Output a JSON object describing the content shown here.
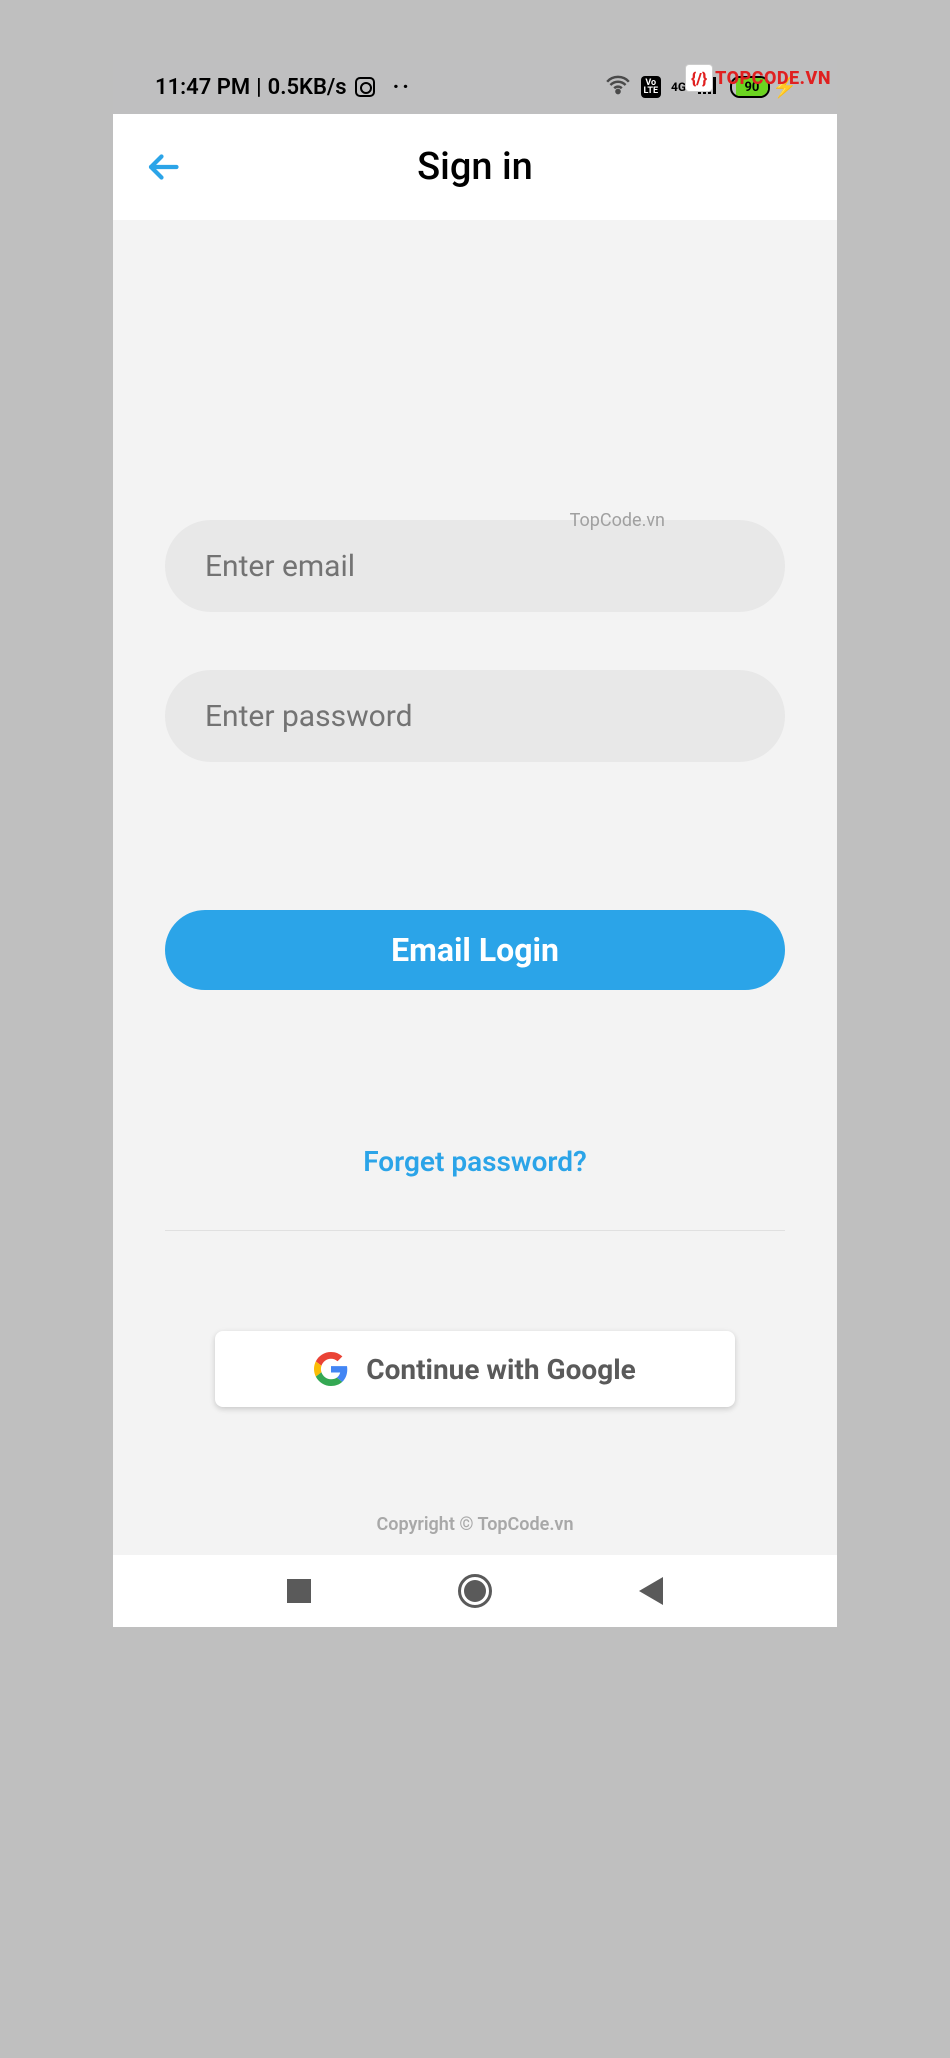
{
  "status_bar": {
    "time": "11:47 PM",
    "data_rate": "0.5KB/s",
    "volte": "Vo\nLTE",
    "network_gen": "4G",
    "battery_percent": "90"
  },
  "header": {
    "title": "Sign in"
  },
  "form": {
    "email_placeholder": "Enter email",
    "password_placeholder": "Enter password",
    "login_button": "Email Login",
    "forget_link": "Forget password?",
    "google_button": "Continue with Google"
  },
  "watermark": {
    "mid": "TopCode.vn",
    "copyright": "Copyright © TopCode.vn",
    "brand": "TOPCODE.VN",
    "mark": "{/}"
  }
}
